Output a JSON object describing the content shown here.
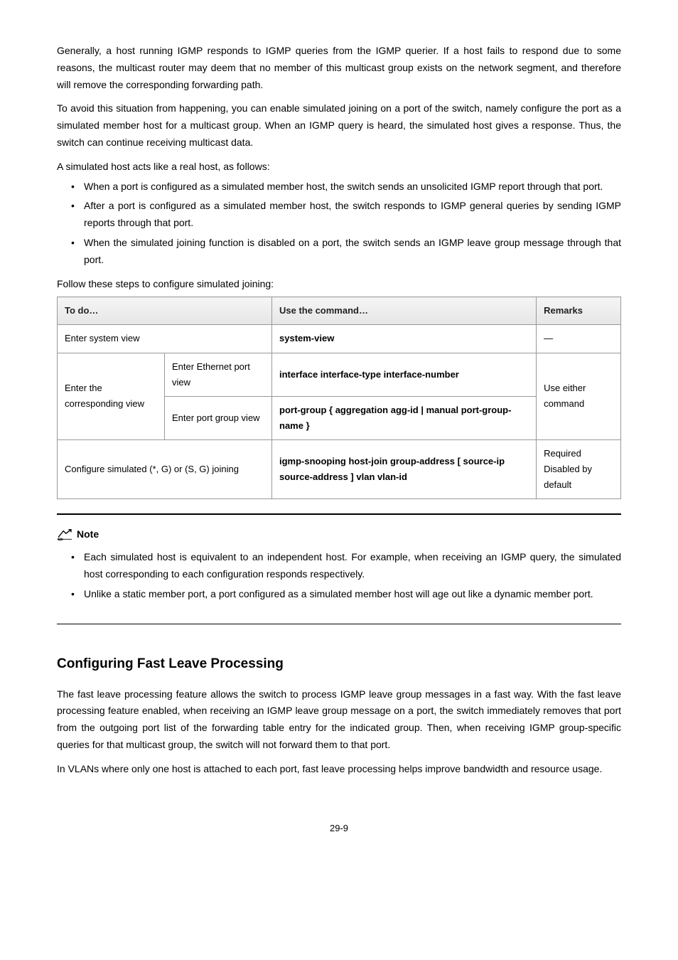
{
  "intro": {
    "p1": "Generally, a host running IGMP responds to IGMP queries from the IGMP querier. If a host fails to respond due to some reasons, the multicast router may deem that no member of this multicast group exists on the network segment, and therefore will remove the corresponding forwarding path.",
    "p2": "To avoid this situation from happening, you can enable simulated joining on a port of the switch, namely configure the port as a simulated member host for a multicast group. When an IGMP query is heard, the simulated host gives a response. Thus, the switch can continue receiving multicast data.",
    "p3": "A simulated host acts like a real host, as follows:",
    "b1": "When a port is configured as a simulated member host, the switch sends an unsolicited IGMP report through that port.",
    "b2": "After a port is configured as a simulated member host, the switch responds to IGMP general queries by sending IGMP reports through that port.",
    "b3": "When the simulated joining function is disabled on a port, the switch sends an IGMP leave group message through that port.",
    "p4": "Follow these steps to configure simulated joining:"
  },
  "table": {
    "h1": "To do…",
    "h2": "Use the command…",
    "h3": "Remarks",
    "r1c1": "Enter system view",
    "r1c2": "system-view",
    "r1c3": "—",
    "r2c1": "Enter the corresponding view",
    "r2c1a": "Enter Ethernet port view",
    "r2c2a": "interface interface-type interface-number",
    "r2c3": "Use either command",
    "r2c1b": "Enter port group view",
    "r2c2b": "port-group { aggregation agg-id | manual port-group-name }",
    "r3c1": "Configure simulated (*, G) or (S, G) joining",
    "r3c2": "igmp-snooping host-join group-address [ source-ip source-address ] vlan vlan-id",
    "r3c3a": "Required",
    "r3c3b": "Disabled by default"
  },
  "note": {
    "label": "Note",
    "b1": "Each simulated host is equivalent to an independent host. For example, when receiving an IGMP query, the simulated host corresponding to each configuration responds respectively.",
    "b2": "Unlike a static member port, a port configured as a simulated member host will age out like a dynamic member port."
  },
  "section2": {
    "title": "Configuring Fast Leave Processing",
    "p1": "The fast leave processing feature allows the switch to process IGMP leave group messages in a fast way. With the fast leave processing feature enabled, when receiving an IGMP leave group message on a port, the switch immediately removes that port from the outgoing port list of the forwarding table entry for the indicated group. Then, when receiving IGMP group-specific queries for that multicast group, the switch will not forward them to that port.",
    "p2": "In VLANs where only one host is attached to each port, fast leave processing helps improve bandwidth and resource usage."
  },
  "footer": "29-9"
}
